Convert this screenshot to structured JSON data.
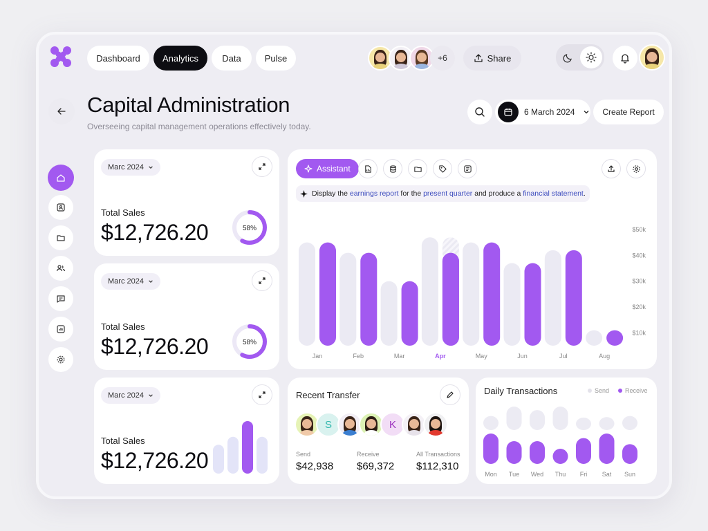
{
  "nav": {
    "tabs": [
      "Dashboard",
      "Analytics",
      "Data",
      "Pulse"
    ],
    "active_tab": "Analytics",
    "collaborators_more": "+6",
    "share_label": "Share"
  },
  "header": {
    "title": "Capital Administration",
    "subtitle": "Overseeing capital management operations effectively today.",
    "date": "6 March 2024",
    "create_report": "Create Report"
  },
  "sales_cards": [
    {
      "month": "Marc 2024",
      "label": "Total Sales",
      "amount": "$12,726.20",
      "progress": "58%",
      "progress_value": 0.58
    },
    {
      "month": "Marc 2024",
      "label": "Total Sales",
      "amount": "$12,726.20",
      "progress": "58%",
      "progress_value": 0.58
    },
    {
      "month": "Marc 2024",
      "label": "Total Sales",
      "amount": "$12,726.20"
    }
  ],
  "assistant": {
    "button": "Assistant",
    "prompt_parts": [
      "Display the ",
      "earnings report",
      " for the ",
      "present quarter",
      " and produce a ",
      "financial statement",
      "."
    ]
  },
  "chart_data": [
    {
      "type": "bar",
      "categories": [
        "Jan",
        "Feb",
        "Mar",
        "Apr",
        "May",
        "Jun",
        "Jul",
        "Aug"
      ],
      "highlight_category": "Apr",
      "y_ticks": [
        "$50k",
        "$40k",
        "$30k",
        "$20k",
        "$10k"
      ],
      "ylim": [
        5,
        50
      ],
      "series": [
        {
          "color": "#ebeaf3",
          "values": [
            45,
            41,
            30,
            47,
            45,
            37,
            42,
            11
          ]
        },
        {
          "color": "#a259f0",
          "values": [
            45,
            41,
            30,
            41,
            45,
            37,
            42,
            11
          ]
        }
      ],
      "grid": false
    },
    {
      "type": "bar",
      "categories": [
        "Mon",
        "Tue",
        "Wed",
        "Thu",
        "Fri",
        "Sat",
        "Sun"
      ],
      "legend": [
        "Send",
        "Receive"
      ],
      "legend_position": "top-right",
      "series": [
        {
          "name": "Send",
          "color": "#ecebf3",
          "values": [
            0.6,
            1.0,
            0.85,
            1.0,
            0.3,
            0.55,
            0.6
          ]
        },
        {
          "name": "Receive",
          "color": "#a259f0",
          "values": [
            1.0,
            0.75,
            0.75,
            0.5,
            0.85,
            1.0,
            0.65
          ]
        }
      ]
    }
  ],
  "recent_transfer": {
    "title": "Recent Transfer",
    "initials": [
      "S",
      "K"
    ],
    "stats": [
      {
        "label": "Send",
        "value": "$42,938"
      },
      {
        "label": "Receive",
        "value": "$69,372"
      },
      {
        "label": "All Transactions",
        "value": "$112,310"
      }
    ]
  },
  "daily": {
    "title": "Daily Transactions"
  },
  "colors": {
    "accent": "#a259f0",
    "light_bar": "#ebeaf3",
    "dark": "#0d0d12"
  },
  "mini_bars": [
    0.55,
    0.7,
    1.0,
    0.7
  ],
  "sidebar_icons": [
    "home-icon",
    "contact-card-icon",
    "folder-icon",
    "users-icon",
    "chat-icon",
    "bar-chart-icon",
    "settings-icon"
  ],
  "tool_icons": [
    "file-chart-icon",
    "database-icon",
    "folder-icon",
    "tag-icon",
    "list-icon"
  ]
}
